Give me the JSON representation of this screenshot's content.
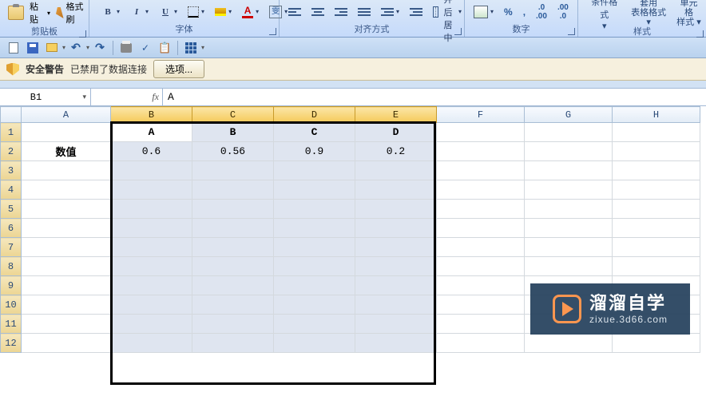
{
  "ribbon": {
    "clipboard": {
      "paste": "粘贴",
      "format_painter": "格式刷",
      "label": "剪贴板"
    },
    "font": {
      "label": "字体",
      "wen": "雯",
      "fontcolor": "A",
      "bold": "B",
      "italic": "I",
      "underline": "U"
    },
    "align": {
      "merge": "合并后居中",
      "label": "对齐方式"
    },
    "number": {
      "btn1": "%",
      "btn2": ",",
      "inc": ".0",
      "label": "数字"
    },
    "styles": {
      "cf": "条件格式",
      "tf": "套用",
      "tf2": "表格格式",
      "cf2": "单元格",
      "cf3": "样式",
      "label": "样式"
    }
  },
  "security": {
    "title": "安全警告",
    "msg": "已禁用了数据连接",
    "btn": "选项..."
  },
  "fxrow": {
    "namebox": "B1",
    "fx": "fx",
    "formula": "A"
  },
  "grid": {
    "cols": [
      "A",
      "B",
      "C",
      "D",
      "E",
      "F",
      "G",
      "H"
    ],
    "rows": [
      "1",
      "2",
      "3",
      "4",
      "5",
      "6",
      "7",
      "8",
      "9",
      "10",
      "11",
      "12"
    ],
    "cells": {
      "A2": "数值",
      "B1": "A",
      "C1": "B",
      "D1": "C",
      "E1": "D",
      "B2": "0.6",
      "C2": "0.56",
      "D2": "0.9",
      "E2": "0.2"
    }
  },
  "watermark": {
    "title": "溜溜自学",
    "url": "zixue.3d66.com"
  }
}
